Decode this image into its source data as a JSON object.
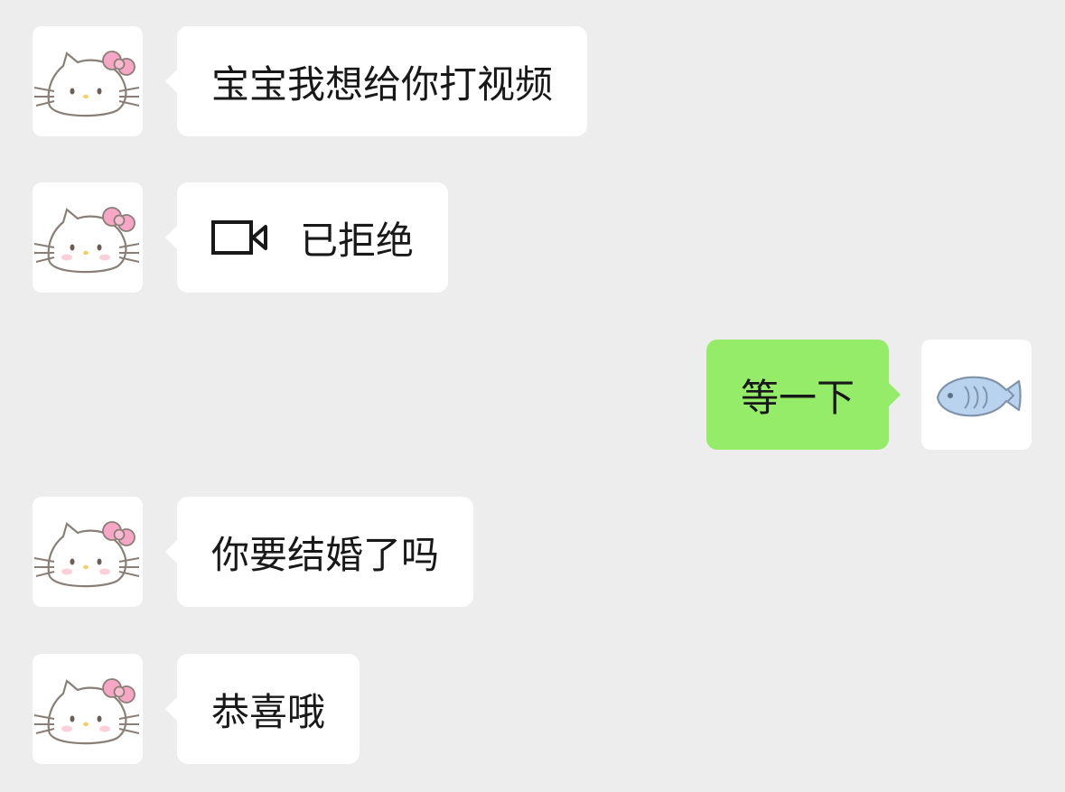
{
  "chat": {
    "messages": [
      {
        "sender": "contact",
        "avatar_icon": "hello-kitty-icon",
        "text": "宝宝我想给你打视频"
      },
      {
        "sender": "contact",
        "avatar_icon": "hello-kitty-icon",
        "message_icon": "video-call-icon",
        "text": "已拒绝"
      },
      {
        "sender": "me",
        "avatar_icon": "blue-fish-icon",
        "text": "等一下"
      },
      {
        "sender": "contact",
        "avatar_icon": "hello-kitty-icon",
        "text": "你要结婚了吗"
      },
      {
        "sender": "contact",
        "avatar_icon": "hello-kitty-icon",
        "text": "恭喜哦"
      }
    ]
  },
  "colors": {
    "background": "#ededed",
    "incoming_bubble": "#ffffff",
    "outgoing_bubble": "#95ec69",
    "text": "#181818",
    "bow": "#f7a7c5",
    "fish": "#b9d3ef"
  }
}
